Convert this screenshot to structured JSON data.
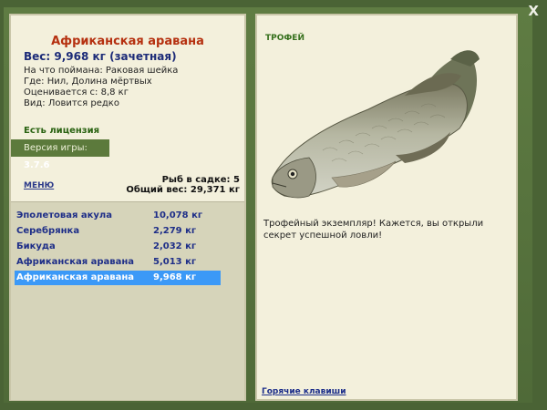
{
  "close_label": "X",
  "fish": {
    "title": "Африканская аравана",
    "weight": "Вес: 9,968 кг (зачетная)",
    "bait": "На что поймана: Раковая шейка",
    "location": "Где: Нил, Долина мёртвых",
    "value": "Оценивается с: 8,8 кг",
    "kind": "Вид: Ловится редко"
  },
  "license": "Есть лицензия",
  "version": {
    "label": "Версия игры:",
    "number": "3.7.6"
  },
  "menu_label": "меню",
  "cage": {
    "count": "Рыб в садке: 5",
    "total": "Общий вес: 29,371 кг"
  },
  "catch_list": [
    {
      "name": "Эполетовая акула",
      "weight": "10,078 кг"
    },
    {
      "name": "Серебрянка",
      "weight": "2,279 кг"
    },
    {
      "name": "Бикуда",
      "weight": "2,032 кг"
    },
    {
      "name": "Африканская аравана",
      "weight": "5,013 кг"
    },
    {
      "name": "Африканская аравана",
      "weight": "9,968 кг"
    }
  ],
  "selected_index": 4,
  "trophy": {
    "label": "ТРОФЕЙ",
    "text": "Трофейный экземпляр! Кажется, вы открыли секрет успешной ловли!"
  },
  "hotkeys": "Горячие клавиши",
  "colors": {
    "accent": "#3b99f7",
    "title": "#b5300f",
    "link": "#1c2e8a"
  }
}
